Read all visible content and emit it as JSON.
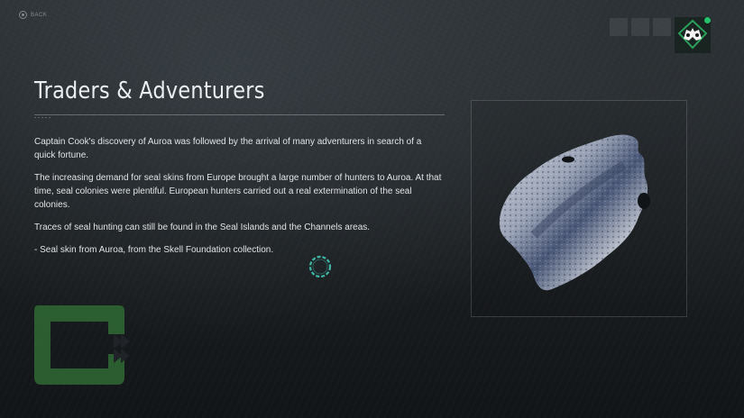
{
  "header": {
    "back_label": "BACK",
    "back_icon": "controller-b-button-icon",
    "slots_icon": "empty-slot",
    "badge_icon": "shield-character-icon",
    "online_color": "#23c26b"
  },
  "article": {
    "title": "Traders & Adventurers",
    "paragraphs": [
      "Captain Cook's discovery of Auroa was followed by the arrival of many adventurers in search of a quick fortune.",
      "The increasing demand for seal skins from Europe brought a large number of hunters to Auroa. At that time, seal colonies were plentiful. European hunters carried out a real extermination of the seal colonies.",
      "Traces of seal hunting can still be found in the Seal Islands and the Channels areas.",
      "- Seal skin from Auroa, from the Skell Foundation collection."
    ]
  },
  "artifact": {
    "icon": "seal-skin-image"
  },
  "colors": {
    "accent_teal": "#3fb7a6",
    "emblem_green": "#2f6a35"
  }
}
